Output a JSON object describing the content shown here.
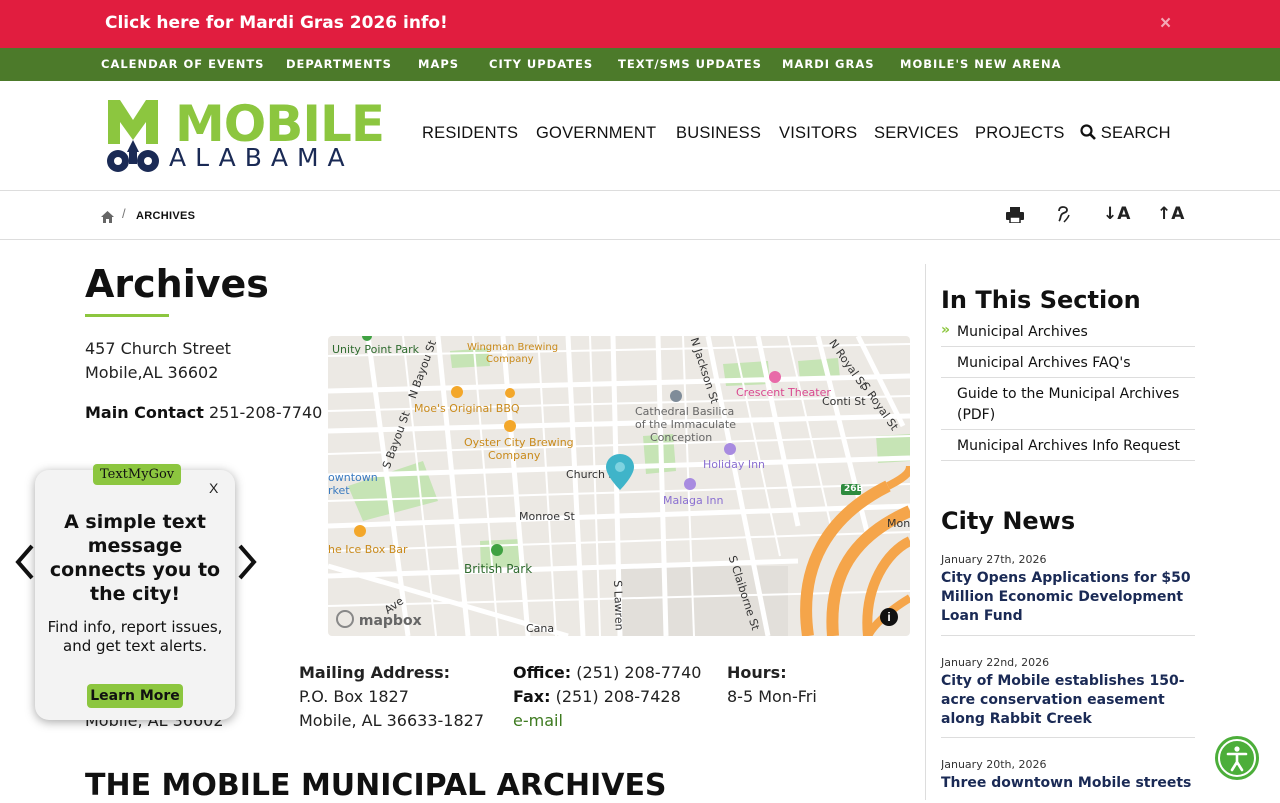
{
  "alert": {
    "text": "Click here for Mardi Gras 2026 info!",
    "close": "×"
  },
  "top_nav": [
    "CALENDAR OF EVENTS",
    "DEPARTMENTS",
    "MAPS",
    "CITY UPDATES",
    "TEXT/SMS UPDATES",
    "MARDI GRAS",
    "MOBILE'S NEW ARENA"
  ],
  "logo": {
    "line1": "MOBILE",
    "line2": "ALABAMA"
  },
  "main_nav": [
    "RESIDENTS",
    "GOVERNMENT",
    "BUSINESS",
    "VISITORS",
    "SERVICES",
    "PROJECTS"
  ],
  "search_label": "SEARCH",
  "breadcrumb": {
    "sep": "/",
    "current": "ARCHIVES"
  },
  "tools": {
    "font_down": "↓A",
    "font_up": "↑A"
  },
  "page": {
    "title": "Archives",
    "address1": "457 Church Street",
    "address2": "Mobile,AL 36602",
    "main_contact_label": "Main Contact",
    "main_contact_phone": "251-208-7740",
    "partial_address": "Mobile, AL 36602",
    "mailing_label": "Mailing Address:",
    "mailing1": "P.O. Box 1827",
    "mailing2": "Mobile, AL 36633-1827",
    "office_label": "Office:",
    "office_phone": "(251) 208-7740",
    "fax_label": "Fax:",
    "fax_phone": "(251) 208-7428",
    "email": "e-mail",
    "hours_label": "Hours:",
    "hours": "8-5 Mon-Fri",
    "bottom_heading": "THE MOBILE MUNICIPAL ARCHIVES"
  },
  "map": {
    "labels": {
      "unity": "Unity Point Park",
      "wingman1": "Wingman Brewing",
      "wingman2": "Company",
      "moes": "Moe's Original BBQ",
      "oyster1": "Oyster City Brewing",
      "oyster2": "Company",
      "cathedral1": "Cathedral Basilica",
      "cathedral2": "of the Immaculate",
      "cathedral3": "Conception",
      "crescent": "Crescent Theater",
      "conti": "Conti St",
      "holiday": "Holiday Inn",
      "church": "Church St",
      "malaga": "Malaga Inn",
      "monroe": "Monroe St",
      "british": "British Park",
      "icebox": "he Ice Box Bar",
      "downtown1": "owntown",
      "downtown2": "rket",
      "claiborne": "S Claiborne St",
      "lawrence": "S Lawren",
      "bayou1": "N Bayou St",
      "bayou2": "S Bayou St",
      "jackson": "N Jackson St",
      "royal1": "N Royal St",
      "royal2": "S Royal St",
      "mon": "Mon",
      "route": "26B",
      "cana": "Cana",
      "mapbox": "mapbox",
      "ave": "Ave"
    }
  },
  "popup": {
    "badge": "TextMyGov",
    "close": "X",
    "headline": "A simple text message connects you to the city!",
    "body": "Find info, report issues, and get text alerts.",
    "button": "Learn More"
  },
  "sidebar": {
    "section_heading": "In This Section",
    "links": [
      "Municipal Archives",
      "Municipal Archives FAQ's",
      "Guide to the Municipal Archives (PDF)",
      "Municipal Archives Info Request"
    ],
    "news_heading": "City News",
    "news": [
      {
        "date": "January 27th, 2026",
        "title": "City Opens Applications for $50 Million Economic Development Loan Fund"
      },
      {
        "date": "January 22nd, 2026",
        "title": "City of Mobile establishes 150-acre conservation easement along Rabbit Creek"
      },
      {
        "date": "January 20th, 2026",
        "title": "Three downtown Mobile streets"
      }
    ]
  },
  "colors": {
    "alert_red": "#e11d3f",
    "nav_green": "#4c7a2a",
    "brand_green": "#8cc63f",
    "brand_navy": "#1a2a55"
  }
}
